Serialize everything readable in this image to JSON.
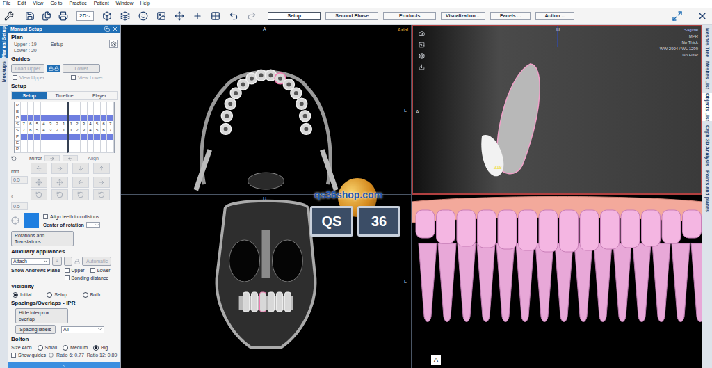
{
  "menu": [
    "File",
    "Edit",
    "View",
    "Go to",
    "Practice",
    "Patient",
    "Window",
    "Help"
  ],
  "toolbar": {
    "view_mode": "2D",
    "phases": [
      {
        "label": "Setup",
        "selected": true
      },
      {
        "label": "Second Phase",
        "selected": false
      },
      {
        "label": "Products",
        "selected": false
      },
      {
        "label": "Visualization ...",
        "selected": false
      },
      {
        "label": "Panels ...",
        "selected": false
      },
      {
        "label": "Action ...",
        "selected": false
      }
    ]
  },
  "left_tabs": [
    {
      "label": "Manual Setup",
      "selected": true
    },
    {
      "label": "Mockups",
      "selected": false
    }
  ],
  "right_tabs": [
    {
      "label": "Meshes Tree",
      "selected": false
    },
    {
      "label": "Meshes List",
      "selected": false
    },
    {
      "label": "Objects List",
      "selected": true
    },
    {
      "label": "Ceph 3D Analysis",
      "selected": false
    },
    {
      "label": "Points and planes",
      "selected": false
    }
  ],
  "panel": {
    "title": "Manual Setup",
    "plan": {
      "heading": "Plan",
      "upper": "Upper : 19",
      "lower": "Lower : 20",
      "mode": "Setup"
    },
    "guides": {
      "heading": "Guides",
      "load_upper": {
        "label": "Load Upper",
        "disabled": true
      },
      "load_lower": {
        "label": "Lower",
        "disabled": true
      },
      "checks": [
        {
          "label": "View Upper",
          "checked": false,
          "disabled": true
        },
        {
          "label": "View Lower",
          "checked": false,
          "disabled": true
        }
      ]
    },
    "setup": {
      "heading": "Setup",
      "tabs": [
        {
          "label": "Setup",
          "selected": true
        },
        {
          "label": "Timeline",
          "selected": false
        },
        {
          "label": "Player",
          "selected": false
        }
      ],
      "chart": {
        "rows": [
          {
            "label": "P",
            "kind": "empty"
          },
          {
            "label": "E",
            "kind": "empty"
          },
          {
            "label": "P",
            "kind": "bar"
          },
          {
            "label": "S",
            "kind": "numbers"
          },
          {
            "label": "S",
            "kind": "numbers"
          },
          {
            "label": "P",
            "kind": "bar"
          },
          {
            "label": "E",
            "kind": "empty"
          },
          {
            "label": "P",
            "kind": "empty"
          }
        ],
        "numbers": [
          "7",
          "6",
          "5",
          "4",
          "3",
          "2",
          "1",
          "1",
          "2",
          "3",
          "4",
          "5",
          "6",
          "7"
        ]
      },
      "mirror": "Mirror",
      "align": "Align",
      "mm": {
        "unit": "mm",
        "step": "0.5"
      },
      "deg": {
        "unit": "°",
        "step": "0.5"
      },
      "align_collisions": {
        "label": "Align teeth in collisions",
        "checked": false
      },
      "center_label": "Center of rotation",
      "rotations": "Rotations and Translations"
    },
    "auxiliary": {
      "heading": "Auxiliary appliances",
      "type": "Attach",
      "add": "+",
      "remove": "-",
      "automatic": "Automatic",
      "andrews": "Show Andrews Plane",
      "checks": [
        {
          "label": "Upper",
          "checked": false
        },
        {
          "label": "Lower",
          "checked": false
        },
        {
          "label": "Bonding distance",
          "checked": false
        }
      ]
    },
    "visibility": {
      "heading": "Visibility",
      "options": [
        {
          "label": "Initial",
          "selected": true
        },
        {
          "label": "Setup",
          "selected": false
        },
        {
          "label": "Both",
          "selected": false
        }
      ]
    },
    "spacings": {
      "heading": "Spacings/Overlaps - IPR",
      "hide": "Hide interprox. overlap",
      "labels": "Spacing labels",
      "filter": "All"
    },
    "bolton": {
      "heading": "Bolton",
      "size_label": "Size Arch",
      "sizes": [
        {
          "label": "Small",
          "selected": false
        },
        {
          "label": "Medium",
          "selected": false
        },
        {
          "label": "Big",
          "selected": true
        }
      ],
      "show_guides": {
        "label": "Show guides",
        "checked": false
      },
      "ratios": [
        "Ratio 6: 0.77",
        "Ratio 12: 0.89"
      ]
    }
  },
  "viewports": {
    "axial": {
      "name": "Axial",
      "top": "A",
      "right": "L"
    },
    "sagittal": {
      "name": "Sagittal",
      "info": [
        "MPR",
        "No Thick",
        "WW 2904 / WL 1299",
        "No Filter"
      ],
      "top": "U",
      "left": "A",
      "tooth": "218"
    },
    "coronal": {
      "top": "U",
      "right": "L"
    },
    "model3d": {
      "corner": "A"
    }
  },
  "watermark": {
    "site": "qs36shop.com",
    "left": "QS",
    "right": "36"
  }
}
